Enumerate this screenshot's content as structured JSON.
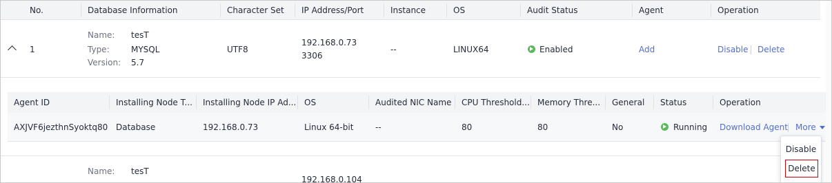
{
  "main_table": {
    "headers": [
      "No.",
      "Database Information",
      "Character Set",
      "IP Address/Port",
      "Instance",
      "OS",
      "Audit Status",
      "Agent",
      "Operation"
    ],
    "rows": [
      {
        "no": "1",
        "name_label": "Name:",
        "name": "tesT",
        "type_label": "Type:",
        "type": "MYSQL",
        "version_label": "Version:",
        "version": "5.7",
        "charset": "UTF8",
        "ip": "192.168.0.73",
        "port": "3306",
        "instance": "--",
        "os": "LINUX64",
        "audit_status": "Enabled",
        "agent_action": "Add",
        "op_disable": "Disable",
        "op_delete": "Delete"
      },
      {
        "name_label": "Name:",
        "name": "tesT",
        "ip": "192.168.0.104"
      }
    ]
  },
  "agent_table": {
    "headers": [
      "Agent ID",
      "Installing Node T...",
      "Installing Node IP Ad...",
      "OS",
      "Audited NIC Name",
      "CPU Threshold...",
      "Memory Thre...",
      "General",
      "Status",
      "Operation"
    ],
    "row": {
      "agent_id": "AXJVF6jezthnSyoktq80",
      "node_type": "Database",
      "node_ip": "192.168.0.73",
      "os": "Linux 64-bit",
      "nic": "--",
      "cpu": "80",
      "memory": "80",
      "general": "No",
      "status": "Running",
      "op_download": "Download Agent",
      "op_more": "More"
    }
  },
  "more_menu": {
    "items": [
      "Disable",
      "Delete"
    ]
  },
  "colors": {
    "link": "#526ecc",
    "status_green": "#5cb85c",
    "highlight_border": "#c7000b",
    "header_bg": "#f3f4f6"
  }
}
